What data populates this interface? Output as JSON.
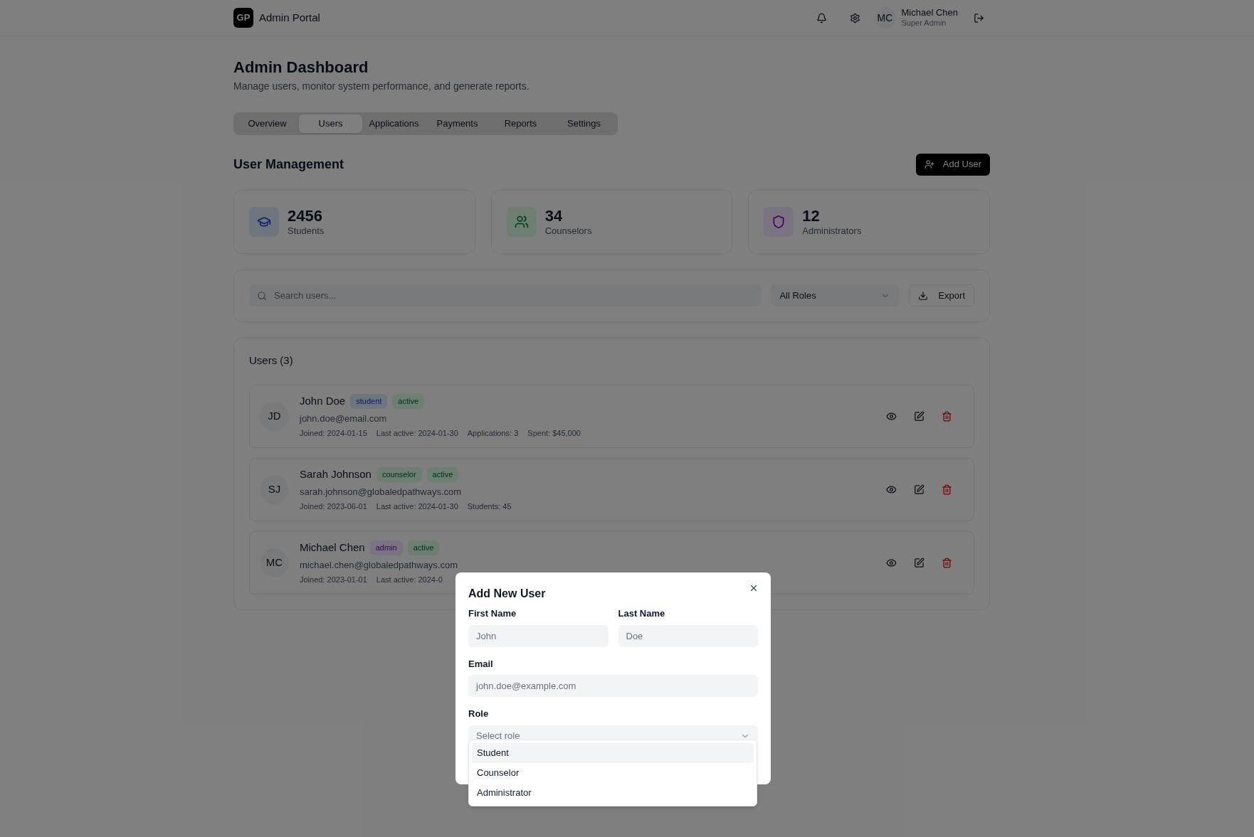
{
  "header": {
    "logo": "GP",
    "title": "Admin Portal",
    "user": {
      "initials": "MC",
      "name": "Michael Chen",
      "role": "Super Admin"
    }
  },
  "page": {
    "title": "Admin Dashboard",
    "subtitle": "Manage users, monitor system performance, and generate reports."
  },
  "tabs": [
    {
      "label": "Overview",
      "selected": false
    },
    {
      "label": "Users",
      "selected": true
    },
    {
      "label": "Applications",
      "selected": false
    },
    {
      "label": "Payments",
      "selected": false
    },
    {
      "label": "Reports",
      "selected": false
    },
    {
      "label": "Settings",
      "selected": false
    }
  ],
  "section": {
    "title": "User Management",
    "add_button": "Add User"
  },
  "stats": [
    {
      "kind": "students",
      "value": "2456",
      "label": "Students"
    },
    {
      "kind": "counselors",
      "value": "34",
      "label": "Counselors"
    },
    {
      "kind": "admins",
      "value": "12",
      "label": "Administrators"
    }
  ],
  "filters": {
    "search": {
      "placeholder": "Search users..."
    },
    "role_select": "All Roles",
    "export_button": "Export"
  },
  "users": {
    "title": "Users (3)",
    "rows": [
      {
        "initials": "JD",
        "name": "John Doe",
        "tags": [
          {
            "label": "student",
            "kind": "student"
          },
          {
            "label": "active",
            "kind": "status"
          }
        ],
        "email": "john.doe@email.com",
        "meta": [
          "Joined: 2024-01-15",
          "Last active: 2024-01-30",
          "Applications: 3",
          "Spent: $45,000"
        ]
      },
      {
        "initials": "SJ",
        "name": "Sarah Johnson",
        "tags": [
          {
            "label": "counselor",
            "kind": "counselor"
          },
          {
            "label": "active",
            "kind": "status"
          }
        ],
        "email": "sarah.johnson@globaledpathways.com",
        "meta": [
          "Joined: 2023-06-01",
          "Last active: 2024-01-30",
          "Students: 45"
        ]
      },
      {
        "initials": "MC",
        "name": "Michael Chen",
        "tags": [
          {
            "label": "admin",
            "kind": "admin"
          },
          {
            "label": "active",
            "kind": "status"
          }
        ],
        "email": "michael.chen@globaledpathways.com",
        "meta": [
          "Joined: 2023-01-01",
          "Last active: 2024-0"
        ]
      }
    ]
  },
  "modal": {
    "title": "Add New User",
    "first_name": {
      "label": "First Name",
      "placeholder": "John"
    },
    "last_name": {
      "label": "Last Name",
      "placeholder": "Doe"
    },
    "email": {
      "label": "Email",
      "placeholder": "john.doe@example.com"
    },
    "role": {
      "label": "Role",
      "placeholder": "Select role"
    },
    "options": [
      {
        "label": "Student",
        "selected": true
      },
      {
        "label": "Counselor",
        "selected": false
      },
      {
        "label": "Administrator",
        "selected": false
      }
    ]
  }
}
